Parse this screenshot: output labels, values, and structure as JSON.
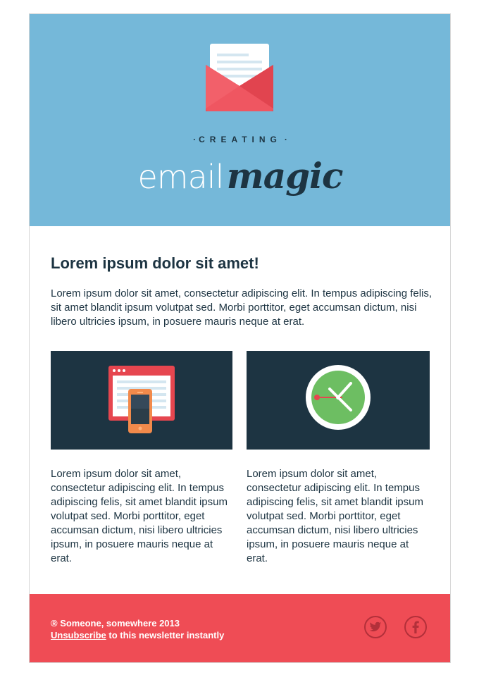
{
  "header": {
    "eyebrow": "CREATING",
    "brand_light": "email",
    "brand_bold": "magic"
  },
  "content": {
    "headline": "Lorem ipsum dolor sit amet!",
    "intro": "Lorem ipsum dolor sit amet, consectetur adipiscing elit. In tempus adipiscing felis, sit amet blandit ipsum volutpat sed. Morbi porttitor, eget accumsan dictum, nisi libero ultricies ipsum, in posuere mauris neque at erat.",
    "cards": [
      {
        "icon": "responsive-devices-icon",
        "text": "Lorem ipsum dolor sit amet, consectetur adipiscing elit. In tempus adipiscing felis, sit amet blandit ipsum volutpat sed. Morbi porttitor, eget accumsan dictum, nisi libero ultricies ipsum, in posuere mauris neque at erat."
      },
      {
        "icon": "clock-icon",
        "text": "Lorem ipsum dolor sit amet, consectetur adipiscing elit. In tempus adipiscing felis, sit amet blandit ipsum volutpat sed. Morbi porttitor, eget accumsan dictum, nisi libero ultricies ipsum, in posuere mauris neque at erat."
      }
    ]
  },
  "footer": {
    "copyright": "® Someone, somewhere 2013",
    "unsubscribe_link": "Unsubscribe",
    "unsubscribe_rest": " to this newsletter instantly",
    "social": [
      "twitter-icon",
      "facebook-icon"
    ]
  },
  "colors": {
    "header_bg": "#75b8d9",
    "dark_navy": "#1d3442",
    "footer_red": "#ef4c55",
    "icon_outline": "#b3303a"
  }
}
